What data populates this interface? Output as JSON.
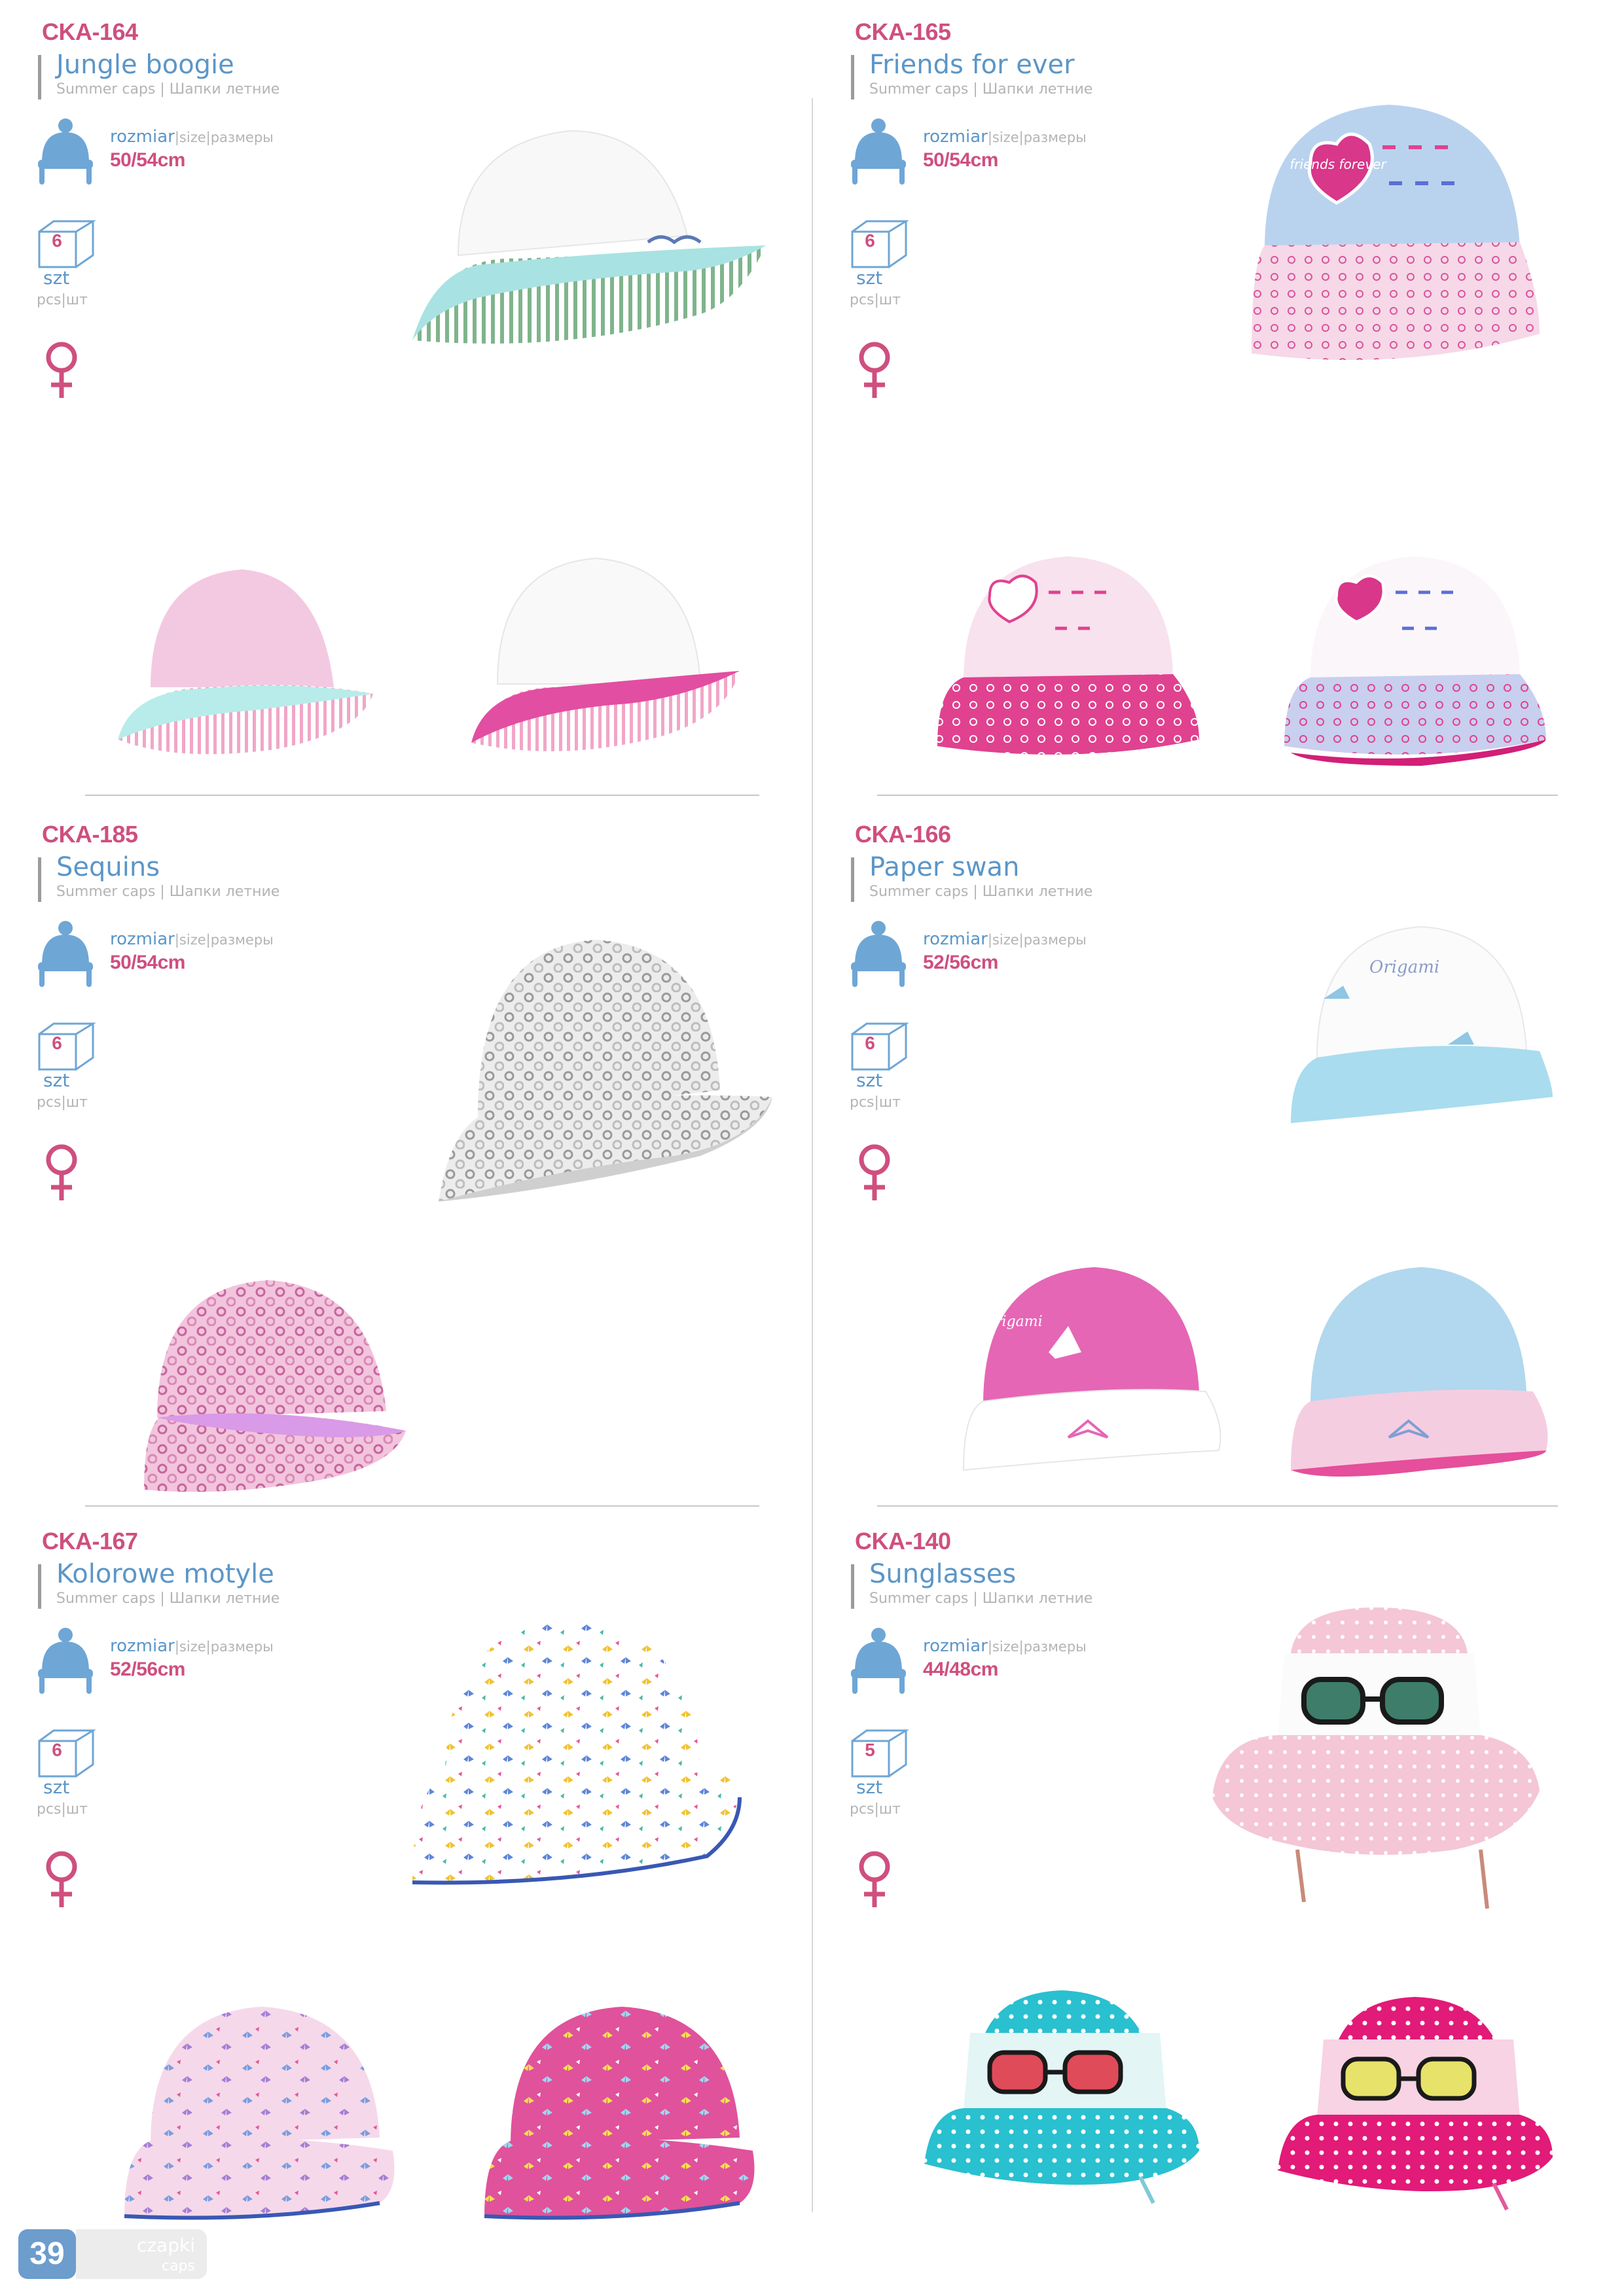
{
  "products": [
    {
      "code": "CKA-164",
      "name": "Jungle boogie",
      "subtitle": "Summer caps | Шапки летние",
      "size_label": "rozmiar",
      "size_label_rest": "|size|размеры",
      "size": "50/54cm",
      "pack_qty": "6",
      "pack_unit": "szt",
      "pack_unit_sub": "pcs|шт",
      "gender": "female-symbol-icon"
    },
    {
      "code": "CKA-165",
      "name": "Friends for ever",
      "subtitle": "Summer caps | Шапки летние",
      "size_label": "rozmiar",
      "size_label_rest": "|size|размеры",
      "size": "50/54cm",
      "pack_qty": "6",
      "pack_unit": "szt",
      "pack_unit_sub": "pcs|шт",
      "gender": "female-symbol-icon"
    },
    {
      "code": "CKA-185",
      "name": "Sequins",
      "subtitle": "Summer caps | Шапки летние",
      "size_label": "rozmiar",
      "size_label_rest": "|size|размеры",
      "size": "50/54cm",
      "pack_qty": "6",
      "pack_unit": "szt",
      "pack_unit_sub": "pcs|шт",
      "gender": "female-symbol-icon"
    },
    {
      "code": "CKA-166",
      "name": "Paper swan",
      "subtitle": "Summer caps | Шапки летние",
      "size_label": "rozmiar",
      "size_label_rest": "|size|размеры",
      "size": "52/56cm",
      "pack_qty": "6",
      "pack_unit": "szt",
      "pack_unit_sub": "pcs|шт",
      "gender": "female-symbol-icon"
    },
    {
      "code": "CKA-167",
      "name": "Kolorowe motyle",
      "subtitle": "Summer caps | Шапки летние",
      "size_label": "rozmiar",
      "size_label_rest": "|size|размеры",
      "size": "52/56cm",
      "pack_qty": "6",
      "pack_unit": "szt",
      "pack_unit_sub": "pcs|шт",
      "gender": "female-symbol-icon"
    },
    {
      "code": "CKA-140",
      "name": "Sunglasses",
      "subtitle": "Summer caps | Шапки летние",
      "size_label": "rozmiar",
      "size_label_rest": "|size|размеры",
      "size": "44/48cm",
      "pack_qty": "5",
      "pack_unit": "szt",
      "pack_unit_sub": "pcs|шт",
      "gender": "female-symbol-icon"
    }
  ],
  "hat_labels": {
    "friends_forever": "friends forever",
    "origami": "Origami"
  },
  "footer": {
    "page_number": "39",
    "section": "czapki",
    "section_sub": "caps"
  },
  "colors": {
    "accent_pink": "#cf4f7f",
    "accent_blue": "#5b96c8",
    "grey": "#b4b4b4"
  }
}
